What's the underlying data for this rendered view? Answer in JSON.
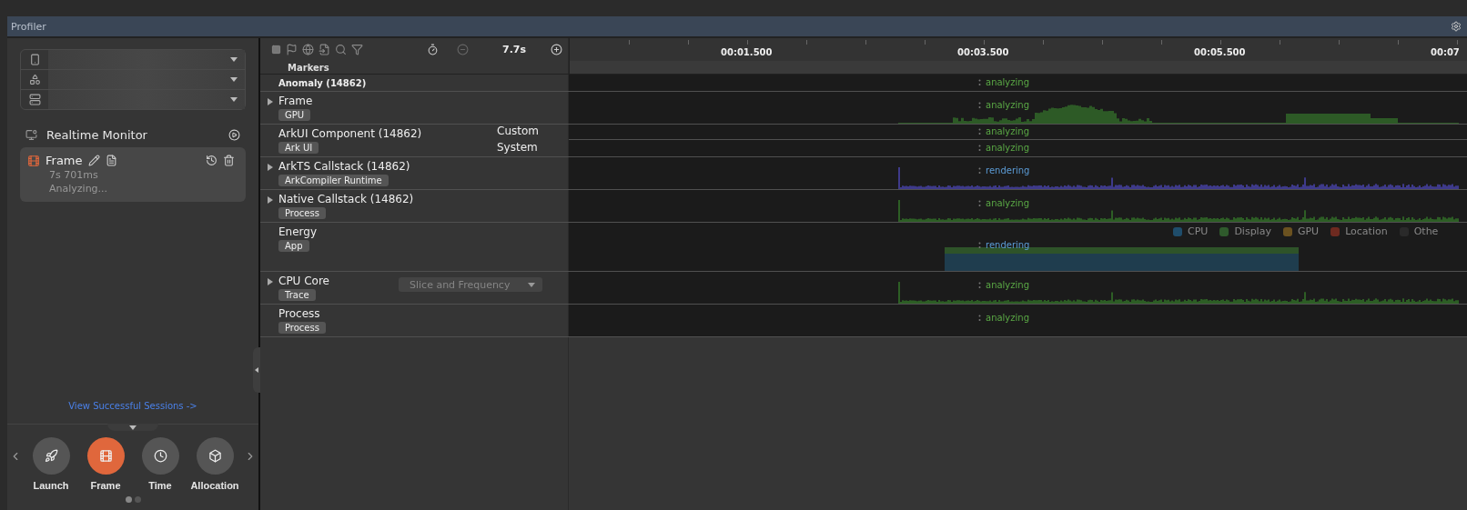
{
  "panel": {
    "title": "Profiler"
  },
  "selectors": [
    {
      "kind": "device"
    },
    {
      "kind": "app"
    },
    {
      "kind": "process"
    }
  ],
  "realtime_monitor": {
    "label": "Realtime Monitor"
  },
  "session": {
    "name": "Frame",
    "duration": "7s 701ms",
    "status": "Analyzing...",
    "selected": true
  },
  "sessions_link": "View Successful Sessions ->",
  "templates": [
    {
      "label": "Launch",
      "kind": "launch",
      "selected": false
    },
    {
      "label": "Frame",
      "kind": "frame",
      "selected": true
    },
    {
      "label": "Time",
      "kind": "time",
      "selected": false
    },
    {
      "label": "Allocation",
      "kind": "allocation",
      "selected": false
    }
  ],
  "pager": [
    {
      "selected": true
    },
    {
      "selected": false
    }
  ],
  "toolbar": {
    "zoom": "7.7s"
  },
  "ruler": {
    "labels": [
      "00:01.500",
      "00:03.500",
      "00:05.500",
      "00:07"
    ]
  },
  "markers_label": "Markers",
  "tracks": [
    {
      "name": "Anomaly (14862)",
      "kind": "plain",
      "expandable": false,
      "lanes": [
        {
          "status": "analyzing",
          "color": "#5aa845"
        }
      ]
    },
    {
      "name": "Frame",
      "kind": "frame",
      "expandable": true,
      "tag": "GPU",
      "lanes": [
        {
          "status": "analyzing",
          "color": "#5aa845"
        }
      ]
    },
    {
      "name": "ArkUI Component (14862)",
      "kind": "plain",
      "expandable": false,
      "tag": "Ark UI",
      "sublabels": [
        "Custom",
        "System"
      ],
      "lanes": [
        {
          "status": "analyzing",
          "color": "#5aa845"
        },
        {
          "status": "analyzing",
          "color": "#5aa845"
        }
      ]
    },
    {
      "name": "ArkTS Callstack (14862)",
      "kind": "callstack",
      "expandable": true,
      "tag": "ArkCompiler Runtime",
      "lanes": [
        {
          "status": "rendering",
          "color": "#5b9bd5"
        }
      ]
    },
    {
      "name": "Native Callstack (14862)",
      "kind": "activity",
      "expandable": true,
      "tag": "Process",
      "lanes": [
        {
          "status": "analyzing",
          "color": "#5aa845"
        }
      ]
    },
    {
      "name": "Energy",
      "kind": "energy",
      "expandable": false,
      "tag": "App",
      "legend": [
        {
          "label": "CPU",
          "color": "#1f4d6b"
        },
        {
          "label": "Display",
          "color": "#2f5a2c"
        },
        {
          "label": "GPU",
          "color": "#6b5220"
        },
        {
          "label": "Location",
          "color": "#6e2a20"
        },
        {
          "label": "Othe",
          "color": "#2a2a2a"
        }
      ],
      "lanes": [
        {
          "status": "rendering",
          "color": "#5b9bd5"
        }
      ]
    },
    {
      "name": "CPU Core",
      "kind": "activity",
      "expandable": true,
      "tag": "Trace",
      "mode_select": {
        "value": "Slice and Frequency",
        "disabled": true
      },
      "lanes": [
        {
          "status": "analyzing",
          "color": "#5aa845"
        }
      ]
    },
    {
      "name": "Process",
      "kind": "plain",
      "expandable": false,
      "tag": "Process",
      "lanes": [
        {
          "status": "analyzing",
          "color": "#5aa845"
        }
      ]
    }
  ]
}
